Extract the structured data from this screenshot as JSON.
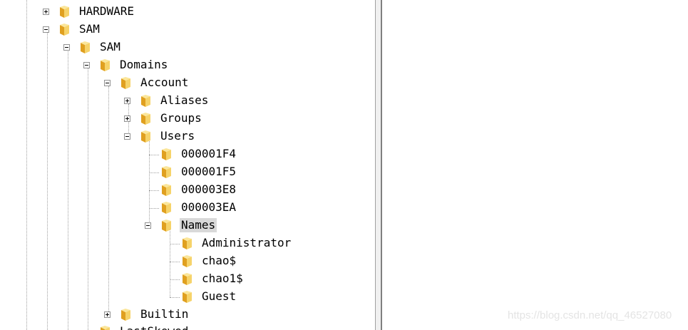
{
  "tree": {
    "hardware": "HARDWARE",
    "sam_root": "SAM",
    "sam": "SAM",
    "domains": "Domains",
    "account": "Account",
    "aliases": "Aliases",
    "groups": "Groups",
    "users": "Users",
    "u1": "000001F4",
    "u2": "000001F5",
    "u3": "000003E8",
    "u4": "000003EA",
    "names": "Names",
    "administrator": "Administrator",
    "chao": "chao$",
    "chao1": "chao1$",
    "guest": "Guest",
    "builtin": "Builtin",
    "partial": "LastSkewed..."
  },
  "watermark": "https://blog.csdn.net/qq_46527080",
  "colors": {
    "folder": "#f0c040",
    "selection": "#d9d9d9"
  },
  "icons": {
    "folder": "folder-icon",
    "expand": "plus-box-icon",
    "collapse": "minus-box-icon"
  }
}
